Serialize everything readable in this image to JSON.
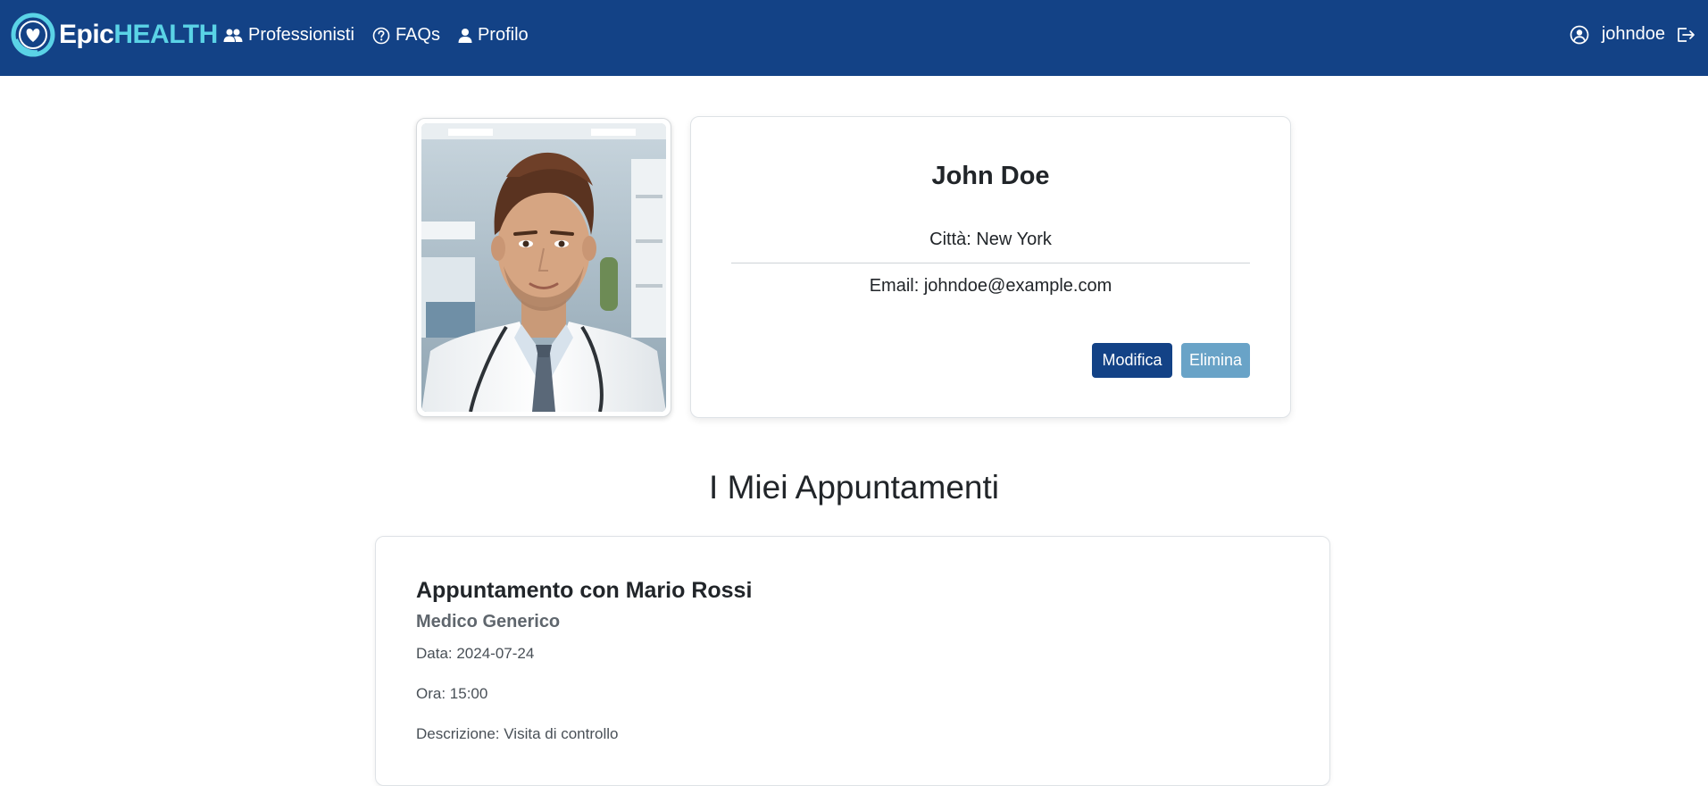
{
  "navbar": {
    "brand_part1": "Epic",
    "brand_part2": "HEALTH",
    "links": [
      {
        "label": "Professionisti",
        "icon": "users-icon"
      },
      {
        "label": "FAQs",
        "icon": "question-circle-icon"
      },
      {
        "label": "Profilo",
        "icon": "person-icon"
      }
    ],
    "username": "johndoe"
  },
  "profile": {
    "name": "John Doe",
    "city": "Città: New York",
    "email": "Email: johndoe@example.com",
    "edit_label": "Modifica",
    "delete_label": "Elimina"
  },
  "appointments": {
    "title": "I Miei Appuntamenti",
    "items": [
      {
        "title": "Appuntamento con Mario Rossi",
        "specialty": "Medico Generico",
        "date": "Data: 2024-07-24",
        "time": "Ora: 15:00",
        "description": "Descrizione: Visita di controllo"
      }
    ]
  },
  "colors": {
    "navbar_bg": "#134286",
    "brand_accent": "#5ad3e6",
    "primary_button": "#134286",
    "secondary_button": "#69a3c7"
  }
}
